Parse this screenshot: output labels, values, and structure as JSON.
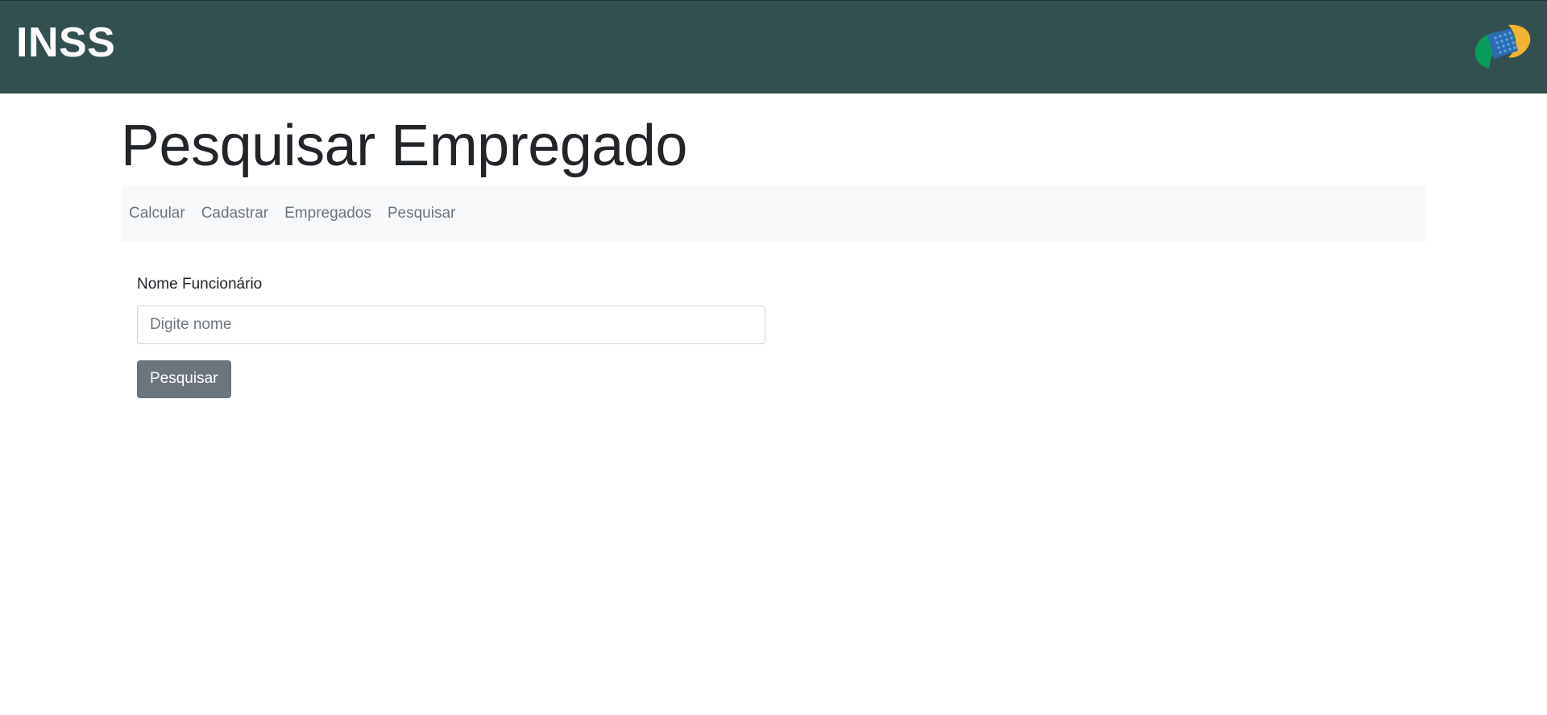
{
  "header": {
    "brand": "INSS",
    "logo_icon": "inss-logo-icon",
    "background_color": "#335050"
  },
  "page": {
    "title": "Pesquisar Empregado"
  },
  "nav": {
    "items": [
      {
        "label": "Calcular"
      },
      {
        "label": "Cadastrar"
      },
      {
        "label": "Empregados"
      },
      {
        "label": "Pesquisar"
      }
    ],
    "background_color": "#f8f9fa"
  },
  "form": {
    "name_label": "Nome Funcionário",
    "name_value": "",
    "name_placeholder": "Digite nome",
    "submit_label": "Pesquisar",
    "button_color": "#6c757d"
  }
}
